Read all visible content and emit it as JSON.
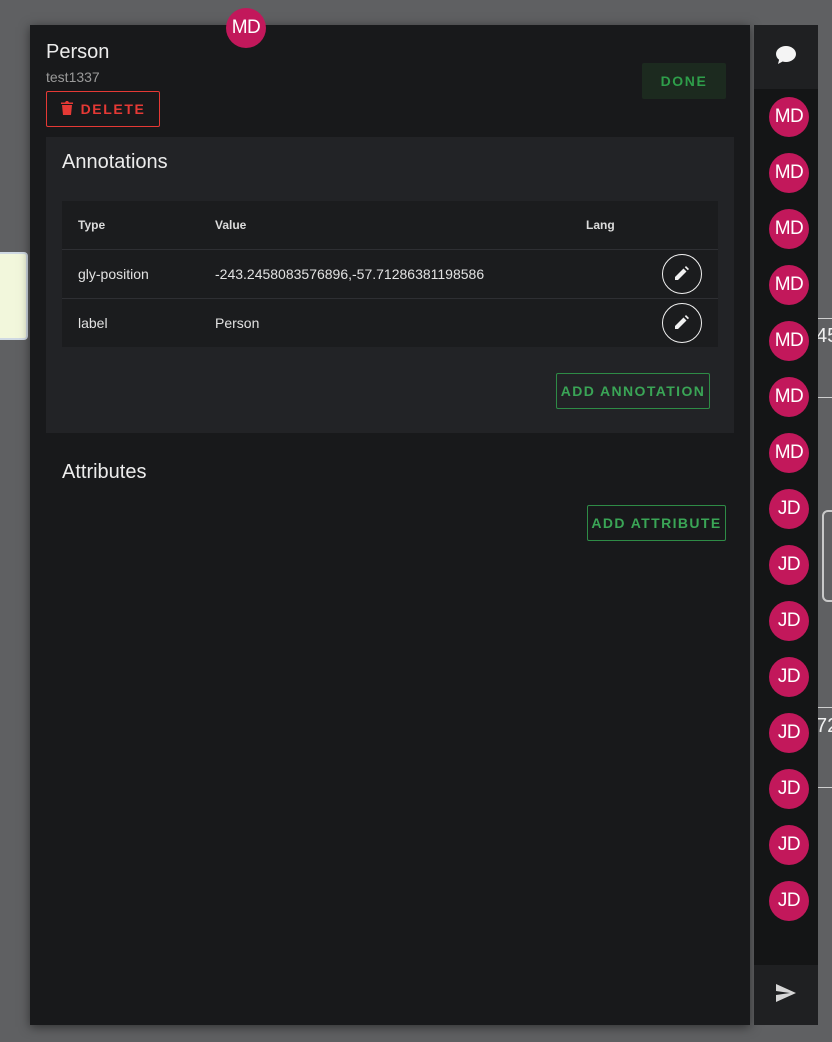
{
  "colors": {
    "accent": "#3aa556",
    "danger": "#e53935",
    "avatar": "#c2185b",
    "panel_bg": "#18191b",
    "card_bg": "#222326"
  },
  "top_avatar": "MD",
  "entity": {
    "title": "Person",
    "id": "test1337",
    "delete_label": "DELETE",
    "done_label": "DONE"
  },
  "annotations": {
    "title": "Annotations",
    "headers": {
      "type": "Type",
      "value": "Value",
      "lang": "Lang"
    },
    "rows": [
      {
        "type": "gly-position",
        "value": "-243.2458083576896,-57.71286381198586",
        "lang": ""
      },
      {
        "type": "label",
        "value": "Person",
        "lang": ""
      }
    ],
    "add_label": "ADD ANNOTATION"
  },
  "attributes": {
    "title": "Attributes",
    "add_label": "ADD ATTRIBUTE"
  },
  "chat": {
    "header_icon": "chat-icon",
    "footer_icon": "send-icon",
    "avatars": [
      "MD",
      "MD",
      "MD",
      "MD",
      "MD",
      "MD",
      "MD",
      "JD",
      "JD",
      "JD",
      "JD",
      "JD",
      "JD",
      "JD",
      "JD"
    ]
  },
  "background": {
    "fragment_1": "45",
    "fragment_2": "72"
  }
}
